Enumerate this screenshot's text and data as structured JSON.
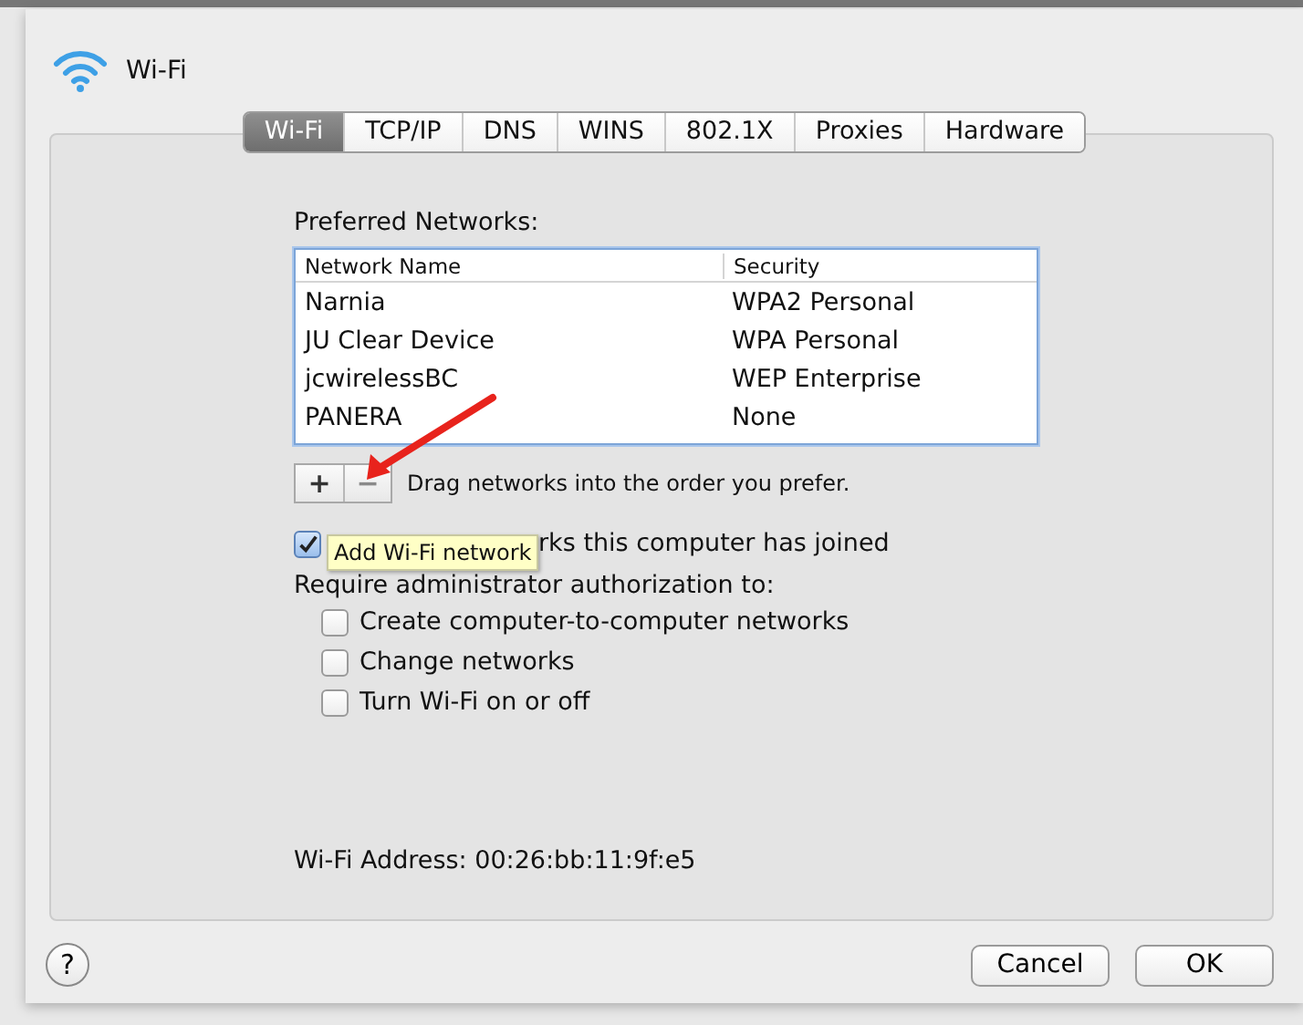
{
  "sheet": {
    "title": "Wi-Fi",
    "tabs": [
      {
        "label": "Wi-Fi",
        "selected": true
      },
      {
        "label": "TCP/IP",
        "selected": false
      },
      {
        "label": "DNS",
        "selected": false
      },
      {
        "label": "WINS",
        "selected": false
      },
      {
        "label": "802.1X",
        "selected": false
      },
      {
        "label": "Proxies",
        "selected": false
      },
      {
        "label": "Hardware",
        "selected": false
      }
    ],
    "preferred_label": "Preferred Networks:",
    "table": {
      "columns": [
        "Network Name",
        "Security"
      ],
      "rows": [
        [
          "Narnia",
          "WPA2 Personal"
        ],
        [
          "JU Clear Device",
          "WPA Personal"
        ],
        [
          "jcwirelessBC",
          "WEP Enterprise"
        ],
        [
          "PANERA",
          "None"
        ]
      ]
    },
    "add_button": {
      "label": "+",
      "disabled": false
    },
    "remove_button": {
      "label": "−",
      "disabled": true
    },
    "drag_hint": "Drag networks into the order you prefer.",
    "remember": {
      "label": "rks this computer has joined",
      "checked": true
    },
    "tooltip": "Add Wi-Fi network",
    "require_label": "Require administrator authorization to:",
    "options": [
      {
        "label": "Create computer-to-computer networks",
        "checked": false
      },
      {
        "label": "Change networks",
        "checked": false
      },
      {
        "label": "Turn Wi-Fi on or off",
        "checked": false
      }
    ],
    "address": "Wi-Fi Address: 00:26:bb:11:9f:e5",
    "help_button": "?",
    "buttons": [
      "Cancel",
      "OK"
    ]
  }
}
